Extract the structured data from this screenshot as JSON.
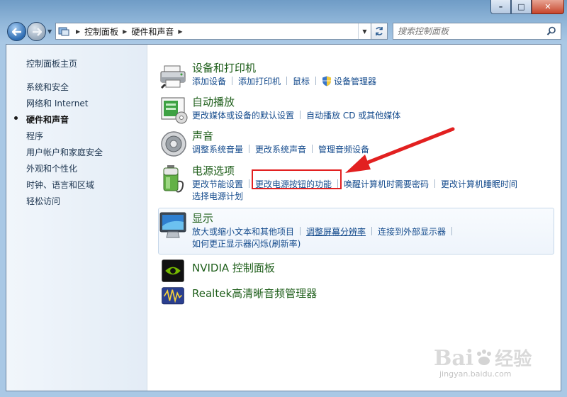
{
  "window": {
    "caption_buttons": [
      "–",
      "□",
      "✕"
    ]
  },
  "address": {
    "crumbs": [
      "控制面板",
      "硬件和声音"
    ]
  },
  "search": {
    "placeholder": "搜索控制面板"
  },
  "sidebar": {
    "items": [
      {
        "label": "控制面板主页",
        "active": false
      },
      {
        "label": "系统和安全",
        "active": false
      },
      {
        "label": "网络和 Internet",
        "active": false
      },
      {
        "label": "硬件和声音",
        "active": true
      },
      {
        "label": "程序",
        "active": false
      },
      {
        "label": "用户帐户和家庭安全",
        "active": false
      },
      {
        "label": "外观和个性化",
        "active": false
      },
      {
        "label": "时钟、语言和区域",
        "active": false
      },
      {
        "label": "轻松访问",
        "active": false
      }
    ]
  },
  "categories": {
    "devices": {
      "title": "设备和打印机",
      "icon": "printer-icon",
      "links": [
        "添加设备",
        "添加打印机",
        "鼠标",
        "设备管理器"
      ]
    },
    "autoplay": {
      "title": "自动播放",
      "icon": "autoplay-icon",
      "links": [
        "更改媒体或设备的默认设置",
        "自动播放 CD 或其他媒体"
      ]
    },
    "sound": {
      "title": "声音",
      "icon": "speaker-icon",
      "links": [
        "调整系统音量",
        "更改系统声音",
        "管理音频设备"
      ]
    },
    "power": {
      "title": "电源选项",
      "icon": "battery-icon",
      "links": [
        "更改节能设置",
        "更改电源按钮的功能",
        "唤醒计算机时需要密码",
        "更改计算机睡眠时间",
        "选择电源计划"
      ]
    },
    "display": {
      "title": "显示",
      "icon": "monitor-icon",
      "links": [
        "放大或缩小文本和其他项目",
        "调整屏幕分辨率",
        "连接到外部显示器",
        "如何更正显示器闪烁(刷新率)"
      ]
    },
    "nvidia": {
      "title": "NVIDIA 控制面板",
      "icon": "nvidia-icon"
    },
    "realtek": {
      "title": "Realtek高清晰音频管理器",
      "icon": "realtek-icon"
    }
  },
  "watermark": {
    "brand": "Bai",
    "brand_suffix": "经验",
    "url": "jingyan.baidu.com"
  },
  "colors": {
    "link": "#134a8c",
    "category_title": "#1e5e1a",
    "highlight": "#e22020"
  }
}
